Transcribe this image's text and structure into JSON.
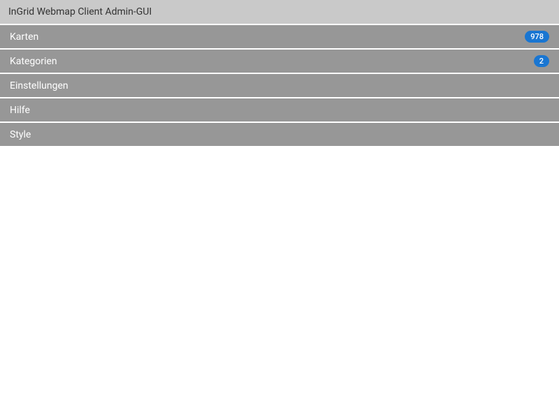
{
  "header": {
    "title": "InGrid Webmap Client Admin-GUI"
  },
  "menu": {
    "items": [
      {
        "label": "Karten",
        "badge": "978"
      },
      {
        "label": "Kategorien",
        "badge": "2"
      },
      {
        "label": "Einstellungen",
        "badge": null
      },
      {
        "label": "Hilfe",
        "badge": null
      },
      {
        "label": "Style",
        "badge": null
      }
    ]
  }
}
